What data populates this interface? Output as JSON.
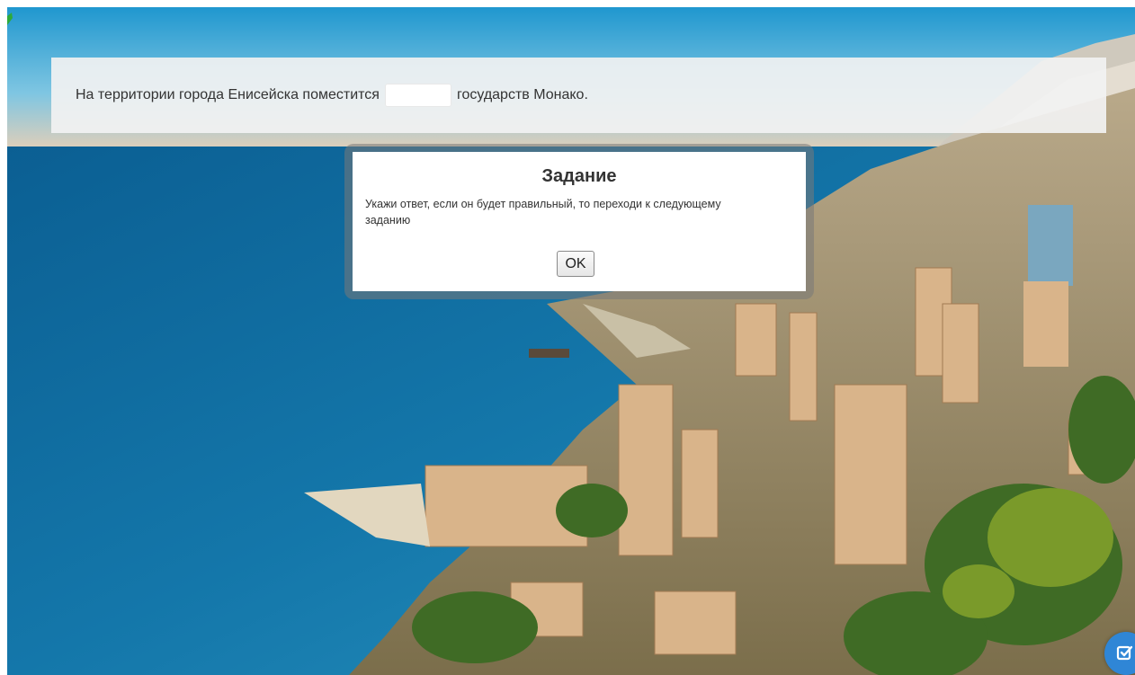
{
  "question": {
    "text_before": "На территории города Енисейска поместится",
    "answer_value": "",
    "text_after": "государств Монако."
  },
  "modal": {
    "title": "Задание",
    "message": "Укажи ответ, если он будет правильный, то переходи к следующему заданию",
    "ok_label": "OK"
  },
  "icons": {
    "badge": "checkbox-edit-icon",
    "marker": "leaf-icon"
  },
  "colors": {
    "badge": "#2f86d6",
    "sea": "#0f6a9c",
    "panel": "#f2f2f2"
  }
}
